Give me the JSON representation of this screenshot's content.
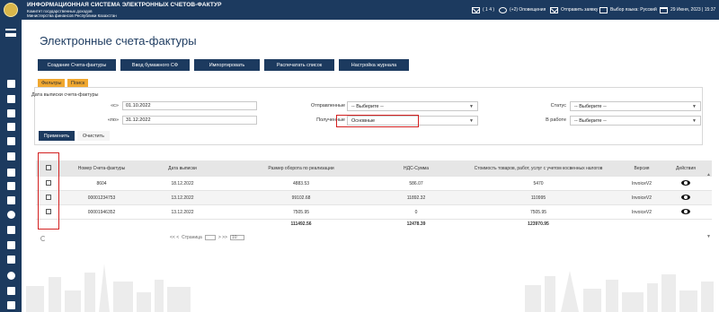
{
  "header": {
    "system_title": "ИНФОРМАЦИОННАЯ СИСТЕМА ЭЛЕКТРОННЫХ СЧЕТОВ-ФАКТУР",
    "subtitle_line1": "Комитет государственных доходов",
    "subtitle_line2": "Министерства финансов Республики Казахстан",
    "messages": "( 1 4 )",
    "notifications": "(+2) Оповещения",
    "send_request": "Отправить заявку",
    "language": "Выбор языка: Русский",
    "datetime": "29 Июня, 2023 | 15:37"
  },
  "page_title": "Электронные счета-фактуры",
  "actions": {
    "create": "Создание Счета-фактуры",
    "paper_input": "Ввод бумажного СФ",
    "import": "Импортировать",
    "print_list": "Распечатать список",
    "journal_settings": "Настройка журнала"
  },
  "tabs": {
    "filters": "Фильтры",
    "search": "Поиск"
  },
  "filters": {
    "date_legend": "Дата выписки счета-фактуры",
    "from_label": "«с»",
    "from_value": "01.10.2022",
    "to_label": "«по»",
    "to_value": "31.12.2022",
    "sent_label": "Отправленные",
    "sent_value": "-- Выберите --",
    "received_label": "Полученные",
    "received_value": "Основные",
    "status_label": "Статус",
    "status_value": "-- Выберите --",
    "in_work_label": "В работе",
    "in_work_value": "-- Выберите --",
    "apply": "Применить",
    "clear": "Очистить"
  },
  "table": {
    "columns": [
      "Номер Счета-фактуры",
      "Дата выписки",
      "Размер оборота по реализации",
      "НДС-Сумма",
      "Стоимость товаров, работ, услуг с учетом косвенных налогов",
      "Версия",
      "Действия"
    ],
    "rows": [
      {
        "number": "8604",
        "date": "18.12.2022",
        "turnover": "4883.53",
        "vat": "586.07",
        "total": "5470",
        "version": "InvoiceV2"
      },
      {
        "number": "00001234753",
        "date": "13.12.2022",
        "turnover": "99102.68",
        "vat": "11892.32",
        "total": "110995",
        "version": "InvoiceV2"
      },
      {
        "number": "00001946352",
        "date": "13.12.2022",
        "turnover": "7505.95",
        "vat": "0",
        "total": "7505.95",
        "version": "InvoiceV2"
      }
    ],
    "totals": {
      "turnover": "111492.56",
      "vat": "12478.39",
      "total": "123970.95"
    }
  },
  "pager": {
    "prev": "<< <",
    "page_label": "Страница",
    "next": "> >>",
    "page_size": "10"
  }
}
